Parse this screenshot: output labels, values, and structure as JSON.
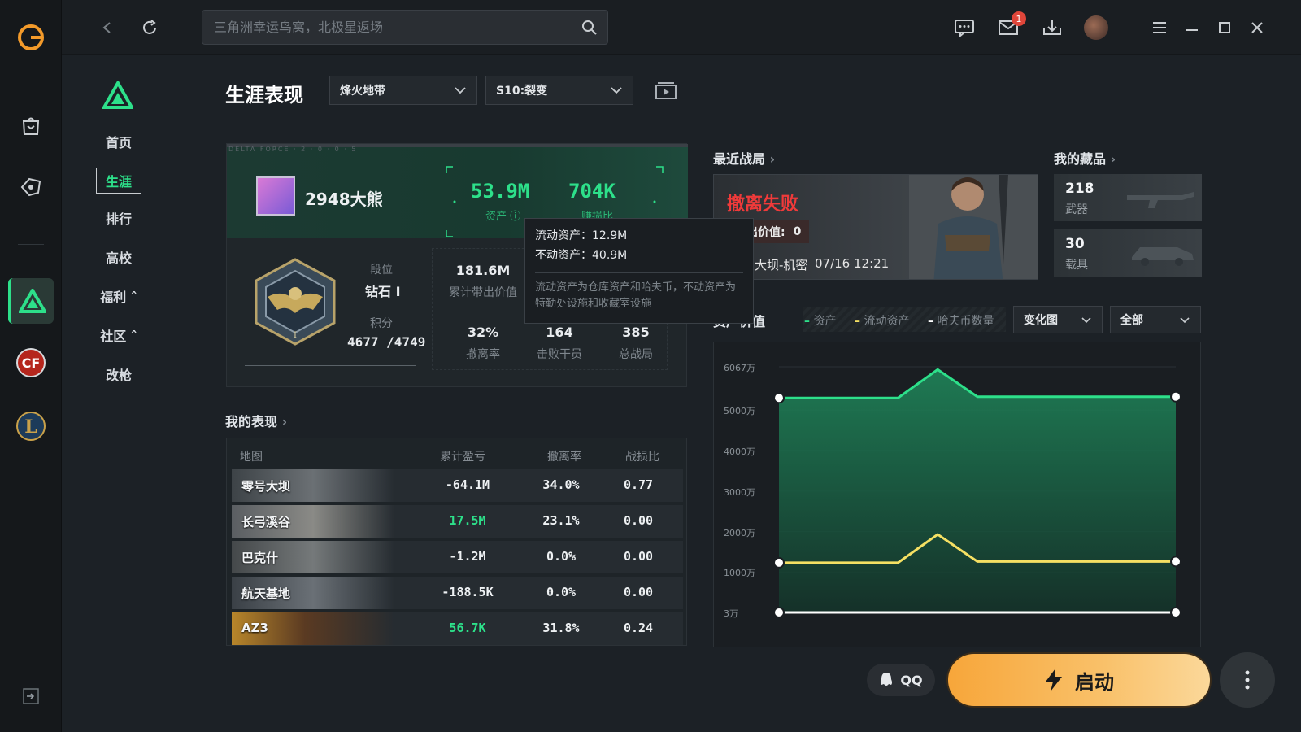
{
  "search": {
    "placeholder": "三角洲幸运鸟窝，北极星返场"
  },
  "topbar": {
    "mail_badge": "1"
  },
  "subnav": {
    "items": [
      {
        "label": "首页"
      },
      {
        "label": "生涯"
      },
      {
        "label": "排行"
      },
      {
        "label": "高校"
      },
      {
        "label": "福利 ˆ"
      },
      {
        "label": "社区 ˆ"
      },
      {
        "label": "改枪"
      }
    ]
  },
  "page": {
    "title": "生涯表现",
    "mode_select": "烽火地带",
    "season_select": "S10:裂变"
  },
  "card": {
    "banner_text": "DELTA FORCE · 2 · 0 · 0 · 5",
    "player_name": "2948大熊",
    "assets_value": "53.9M",
    "assets_label": "资产",
    "kd_value": "704K",
    "kd_label": "赚损比",
    "rank_label": "段位",
    "rank_value": "钻石 I",
    "score_label": "积分",
    "score_value": "4677 /4749",
    "stats": [
      {
        "value": "181.6M",
        "label": "累计带出价值"
      },
      {
        "value": "32%",
        "label": "撤离率"
      },
      {
        "value": "164",
        "label": "击败干员"
      },
      {
        "value": "385",
        "label": "总战局"
      }
    ]
  },
  "tooltip": {
    "liquid_label": "流动资产：",
    "liquid_value": "12.9M",
    "fixed_label": "不动资产：",
    "fixed_value": "40.9M",
    "note": "流动资产为仓库资产和哈夫币，不动资产为特勤处设施和收藏室设施"
  },
  "performance": {
    "title": "我的表现",
    "headers": [
      "地图",
      "累计盈亏",
      "撤离率",
      "战损比"
    ],
    "rows": [
      {
        "map": "零号大坝",
        "profit": "-64.1M",
        "rate": "34.0%",
        "kd": "0.77",
        "green": false
      },
      {
        "map": "长弓溪谷",
        "profit": "17.5M",
        "rate": "23.1%",
        "kd": "0.00",
        "green": true
      },
      {
        "map": "巴克什",
        "profit": "-1.2M",
        "rate": "0.0%",
        "kd": "0.00",
        "green": false
      },
      {
        "map": "航天基地",
        "profit": "-188.5K",
        "rate": "0.0%",
        "kd": "0.00",
        "green": false
      },
      {
        "map": "AZ3",
        "profit": "56.7K",
        "rate": "31.8%",
        "kd": "0.24",
        "green": true
      }
    ]
  },
  "recent": {
    "title": "最近战局",
    "result": "撤离失败",
    "value_label": "带出价值:",
    "value": "0",
    "map": "大坝-机密",
    "time": "07/16 12:21"
  },
  "collection": {
    "title": "我的藏品",
    "items": [
      {
        "count": "218",
        "label": "武器"
      },
      {
        "count": "30",
        "label": "载具"
      }
    ]
  },
  "chart_section": {
    "title": "资产价值",
    "legend": [
      "资产",
      "流动资产",
      "哈夫币数量"
    ],
    "view_select": "变化图",
    "range_select": "全部"
  },
  "footer": {
    "qq_label": "QQ",
    "start_label": "启动"
  },
  "colors": {
    "accent": "#2de08a",
    "danger": "#f03a3a",
    "yellow": "#f5e063",
    "start": "#f7a63a"
  },
  "chart_data": {
    "type": "line",
    "x": [
      0,
      1,
      2,
      3,
      4,
      5,
      6,
      7,
      8,
      9,
      10
    ],
    "ylabel": "",
    "yticks": [
      "3万",
      "1000万",
      "2000万",
      "3000万",
      "4000万",
      "5000万",
      "6067万"
    ],
    "ylim": [
      3,
      6067
    ],
    "series": [
      {
        "name": "资产",
        "color": "#2de08a",
        "values": [
          5300,
          5300,
          5300,
          5300,
          6000,
          5330,
          5330,
          5330,
          5330,
          5330,
          5330
        ]
      },
      {
        "name": "流动资产",
        "color": "#f5e063",
        "values": [
          1230,
          1230,
          1230,
          1230,
          1930,
          1260,
          1260,
          1260,
          1260,
          1260,
          1260
        ]
      },
      {
        "name": "哈夫币数量",
        "color": "#ffffff",
        "values": [
          3,
          3,
          3,
          3,
          3,
          3,
          3,
          3,
          3,
          3,
          3
        ]
      }
    ]
  }
}
